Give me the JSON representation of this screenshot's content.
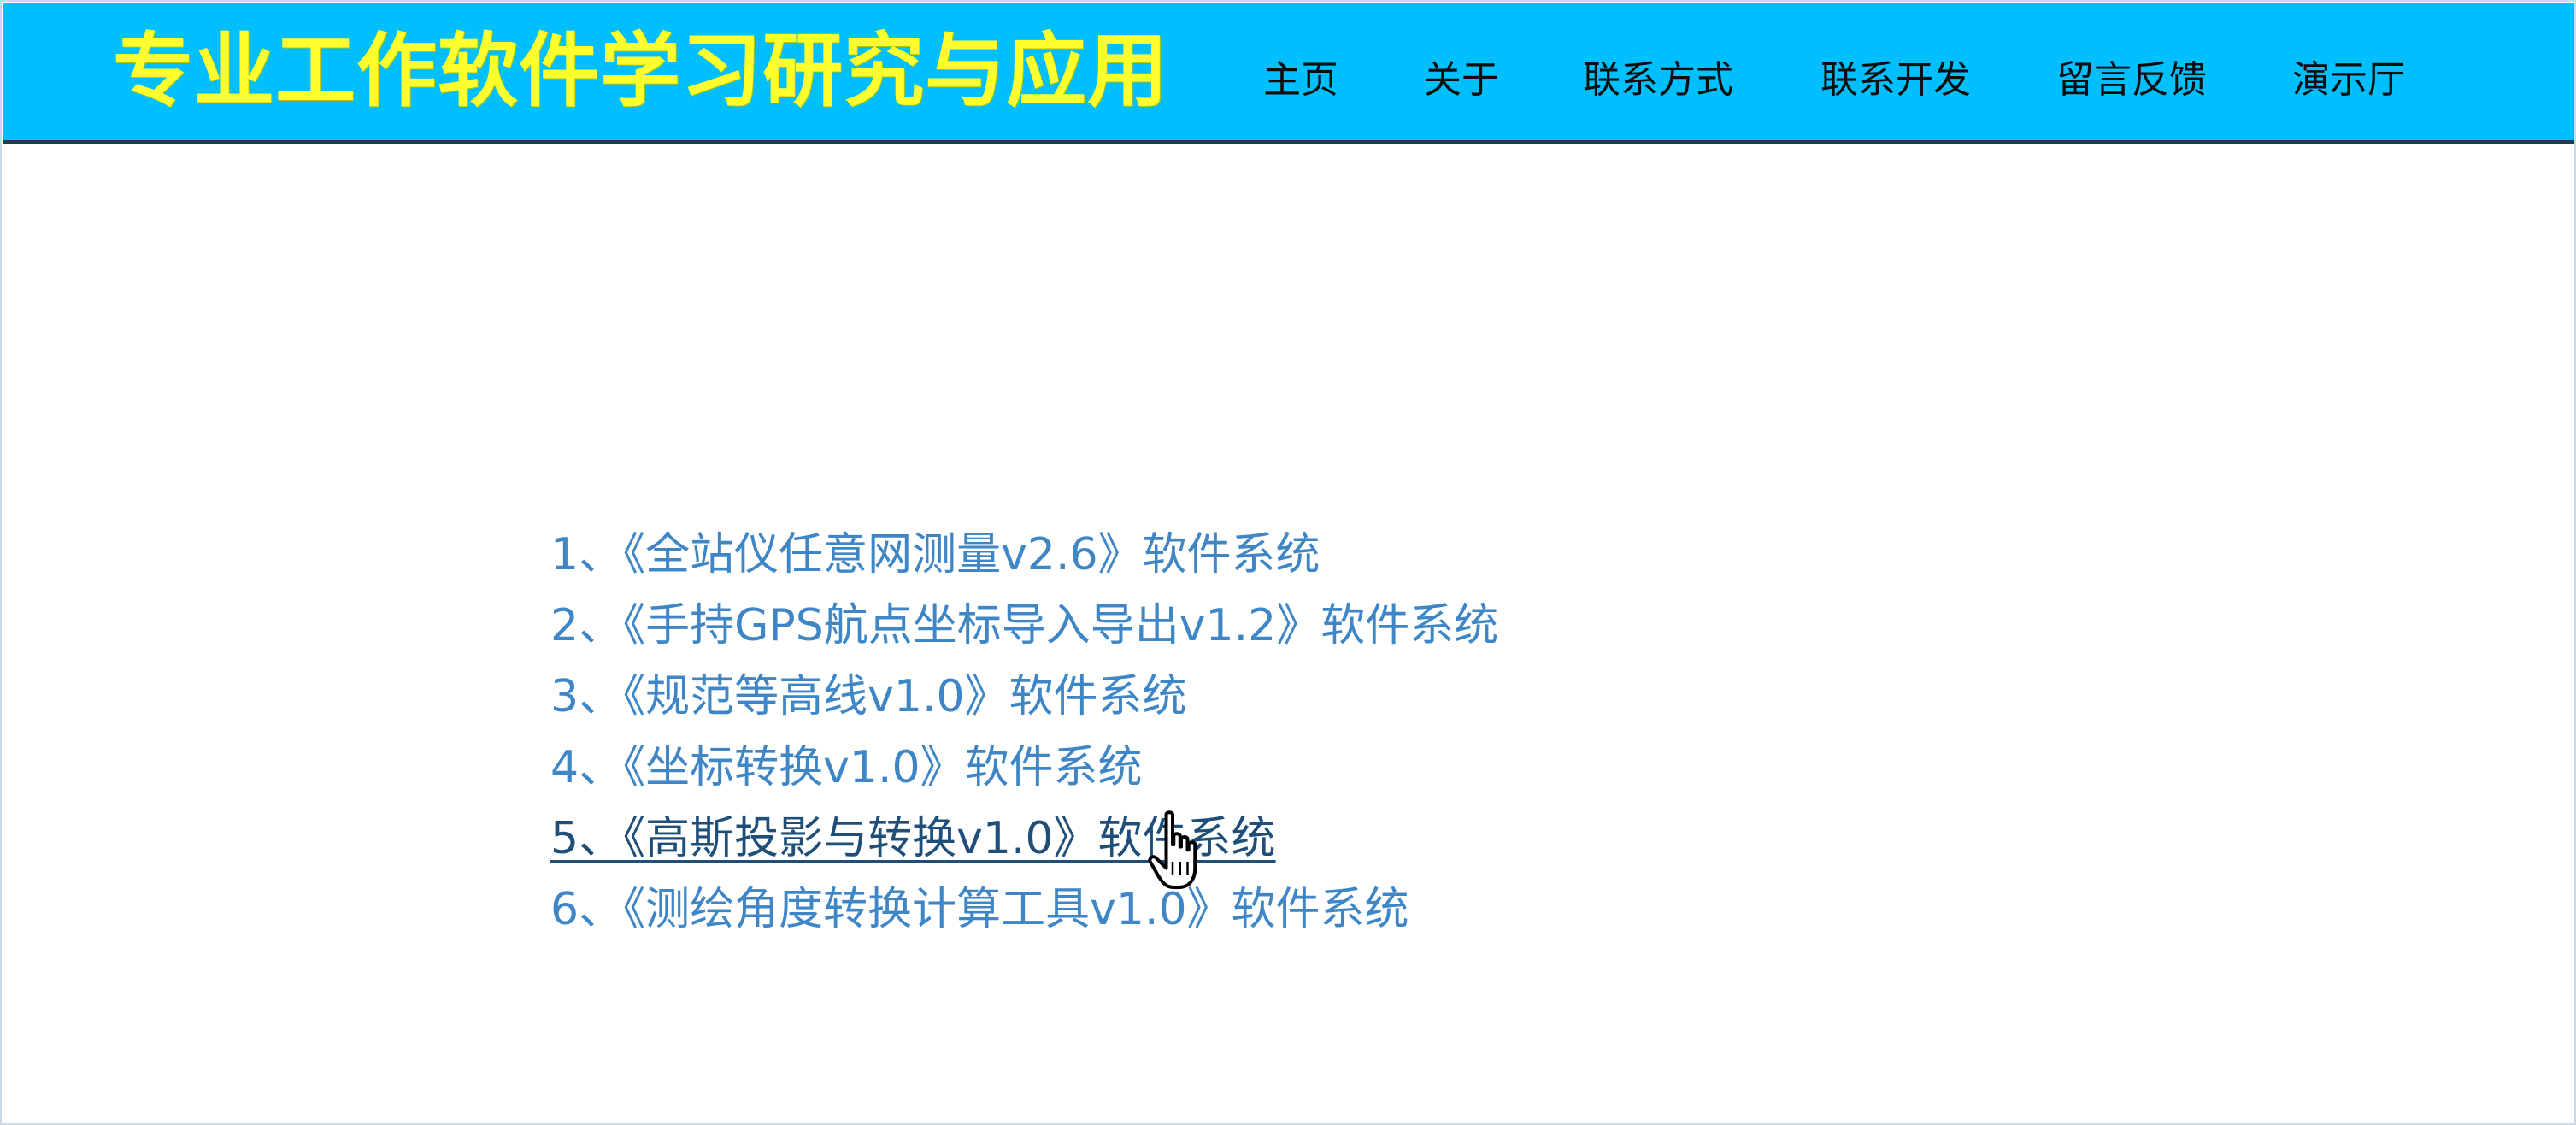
{
  "header": {
    "site_title": "专业工作软件学习研究与应用",
    "nav": [
      {
        "label": "主页"
      },
      {
        "label": "关于"
      },
      {
        "label": "联系方式"
      },
      {
        "label": "联系开发"
      },
      {
        "label": "留言反馈"
      },
      {
        "label": "演示厅"
      }
    ]
  },
  "software_list": {
    "items": [
      {
        "label": "1、《全站仪任意网测量v2.6》软件系统"
      },
      {
        "label": "2、《手持GPS航点坐标导入导出v1.2》软件系统"
      },
      {
        "label": "3、《规范等高线v1.0》软件系统"
      },
      {
        "label": "4、《坐标转换v1.0》软件系统"
      },
      {
        "label": "5、《高斯投影与转换v1.0》软件系统"
      },
      {
        "label": "6、《测绘角度转换计算工具v1.0》软件系统"
      }
    ],
    "hovered_index": 4
  },
  "colors": {
    "header_bg": "#00bfff",
    "title_text": "#ffff2e",
    "link_text": "#3f86c6",
    "link_hover_text": "#1f4e79"
  },
  "icons": {
    "cursor": "hand-pointer-cursor-icon"
  }
}
